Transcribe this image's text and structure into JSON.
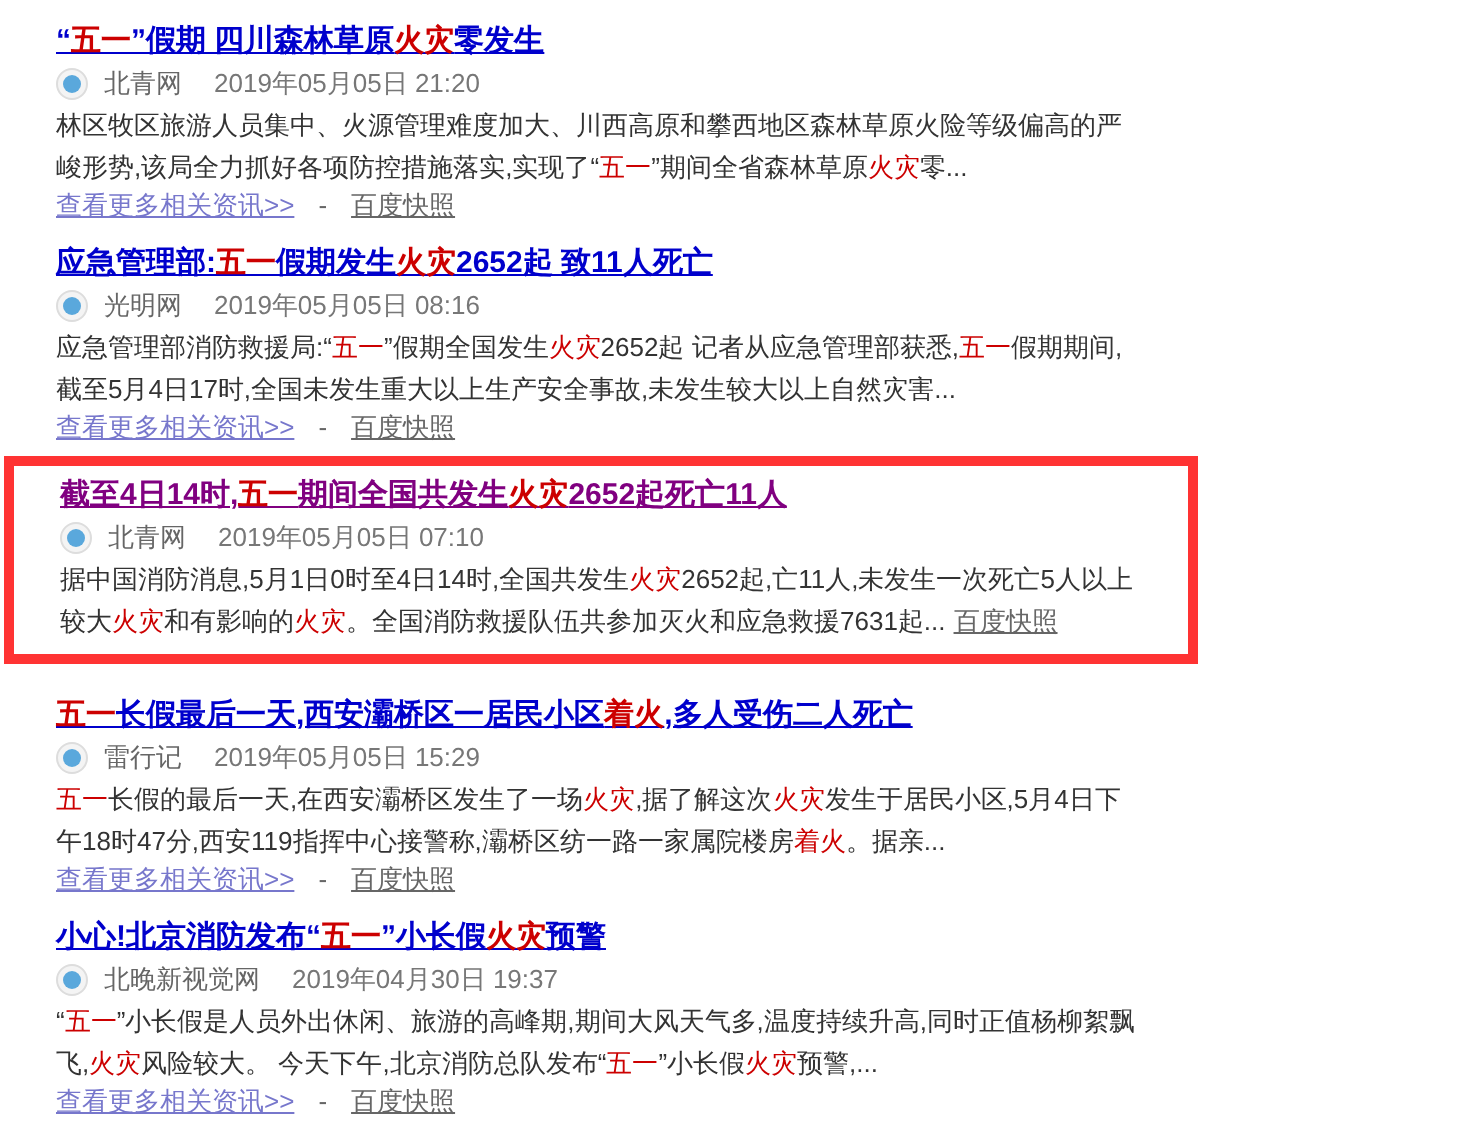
{
  "results": [
    {
      "boxed": false,
      "visited": false,
      "title": [
        {
          "text": "“",
          "highlight": false
        },
        {
          "text": "五一",
          "highlight": true
        },
        {
          "text": "”假期 四川森林草原",
          "highlight": false
        },
        {
          "text": "火灾",
          "highlight": true
        },
        {
          "text": "零发生",
          "highlight": false
        }
      ],
      "source": "北青网",
      "time": "2019年05月05日 21:20",
      "snippet": [
        {
          "text": "林区牧区旅游人员集中、火源管理难度加大、川西高原和攀西地区森林草原火险等级偏高的严峻形势,该局全力抓好各项防控措施落实,实现了“",
          "highlight": false
        },
        {
          "text": "五一",
          "highlight": true
        },
        {
          "text": "”期间全省森林草原",
          "highlight": false
        },
        {
          "text": "火灾",
          "highlight": true
        },
        {
          "text": "零...",
          "highlight": false
        }
      ],
      "more_link": "查看更多相关资讯>>",
      "separator": "-",
      "snapshot": "百度快照"
    },
    {
      "boxed": false,
      "visited": false,
      "title": [
        {
          "text": "应急管理部:",
          "highlight": false
        },
        {
          "text": "五一",
          "highlight": true
        },
        {
          "text": "假期发生",
          "highlight": false
        },
        {
          "text": "火灾",
          "highlight": true
        },
        {
          "text": "2652起 致11人死亡",
          "highlight": false
        }
      ],
      "source": "光明网",
      "time": "2019年05月05日 08:16",
      "snippet": [
        {
          "text": "应急管理部消防救援局:“",
          "highlight": false
        },
        {
          "text": "五一",
          "highlight": true
        },
        {
          "text": "”假期全国发生",
          "highlight": false
        },
        {
          "text": "火灾",
          "highlight": true
        },
        {
          "text": "2652起 记者从应急管理部获悉,",
          "highlight": false
        },
        {
          "text": "五一",
          "highlight": true
        },
        {
          "text": "假期期间,截至5月4日17时,全国未发生重大以上生产安全事故,未发生较大以上自然灾害...",
          "highlight": false
        }
      ],
      "more_link": "查看更多相关资讯>>",
      "separator": "-",
      "snapshot": "百度快照"
    },
    {
      "boxed": true,
      "visited": true,
      "title": [
        {
          "text": "截至4日14时,",
          "highlight": false
        },
        {
          "text": "五一",
          "highlight": true
        },
        {
          "text": "期间全国共发生",
          "highlight": false
        },
        {
          "text": "火灾",
          "highlight": true
        },
        {
          "text": "2652起死亡11人",
          "highlight": false
        }
      ],
      "source": "北青网",
      "time": "2019年05月05日 07:10",
      "snippet": [
        {
          "text": "据中国消防消息,5月1日0时至4日14时,全国共发生",
          "highlight": false
        },
        {
          "text": "火灾",
          "highlight": true
        },
        {
          "text": "2652起,亡11人,未发生一次死亡5人以上较大",
          "highlight": false
        },
        {
          "text": "火灾",
          "highlight": true
        },
        {
          "text": "和有影响的",
          "highlight": false
        },
        {
          "text": "火灾",
          "highlight": true
        },
        {
          "text": "。全国消防救援队伍共参加灭火和应急救援7631起...",
          "highlight": false
        }
      ],
      "snapshot": "百度快照"
    },
    {
      "boxed": false,
      "visited": false,
      "title": [
        {
          "text": "五一",
          "highlight": true
        },
        {
          "text": "长假最后一天,西安灞桥区一居民小区",
          "highlight": false
        },
        {
          "text": "着火",
          "highlight": true
        },
        {
          "text": ",多人受伤二人死亡",
          "highlight": false
        }
      ],
      "source": "雷行记",
      "time": "2019年05月05日 15:29",
      "snippet": [
        {
          "text": "五一",
          "highlight": true
        },
        {
          "text": "长假的最后一天,在西安灞桥区发生了一场",
          "highlight": false
        },
        {
          "text": "火灾",
          "highlight": true
        },
        {
          "text": ",据了解这次",
          "highlight": false
        },
        {
          "text": "火灾",
          "highlight": true
        },
        {
          "text": "发生于居民小区,5月4日下午18时47分,西安119指挥中心接警称,灞桥区纺一路一家属院楼房",
          "highlight": false
        },
        {
          "text": "着火",
          "highlight": true
        },
        {
          "text": "。据亲...",
          "highlight": false
        }
      ],
      "more_link": "查看更多相关资讯>>",
      "separator": "-",
      "snapshot": "百度快照"
    },
    {
      "boxed": false,
      "visited": false,
      "title": [
        {
          "text": "小心!北京消防发布“",
          "highlight": false
        },
        {
          "text": "五一",
          "highlight": true
        },
        {
          "text": "”小长假",
          "highlight": false
        },
        {
          "text": "火灾",
          "highlight": true
        },
        {
          "text": "预警",
          "highlight": false
        }
      ],
      "source": "北晚新视觉网",
      "time": "2019年04月30日 19:37",
      "snippet": [
        {
          "text": "“",
          "highlight": false
        },
        {
          "text": "五一",
          "highlight": true
        },
        {
          "text": "”小长假是人员外出休闲、旅游的高峰期,期间大风天气多,温度持续升高,同时正值杨柳絮飘飞,",
          "highlight": false
        },
        {
          "text": "火灾",
          "highlight": true
        },
        {
          "text": "风险较大。 今天下午,北京消防总队发布“",
          "highlight": false
        },
        {
          "text": "五一",
          "highlight": true
        },
        {
          "text": "”小长假",
          "highlight": false
        },
        {
          "text": "火灾",
          "highlight": true
        },
        {
          "text": "预警,...",
          "highlight": false
        }
      ],
      "more_link": "查看更多相关资讯>>",
      "separator": "-",
      "snapshot": "百度快照"
    }
  ]
}
